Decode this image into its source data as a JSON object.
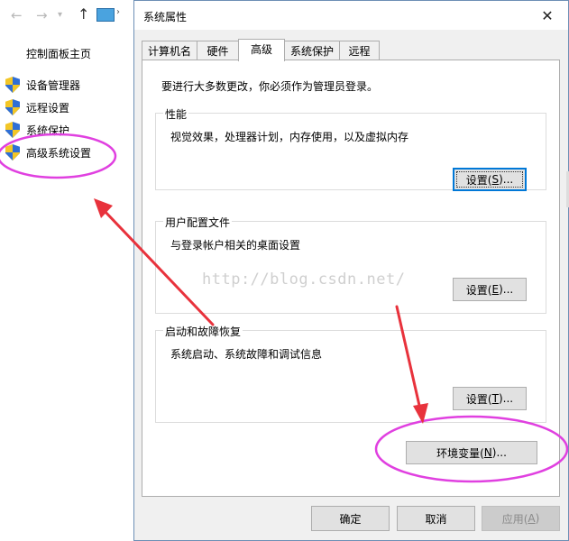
{
  "control_panel": {
    "home_label": "控制面板主页",
    "side_items": [
      {
        "label": "设备管理器"
      },
      {
        "label": "远程设置"
      },
      {
        "label": "系统保护"
      },
      {
        "label": "高级系统设置"
      }
    ]
  },
  "dialog": {
    "title": "系统属性",
    "tabs": [
      {
        "label": "计算机名"
      },
      {
        "label": "硬件"
      },
      {
        "label": "高级",
        "active": true
      },
      {
        "label": "系统保护"
      },
      {
        "label": "远程"
      }
    ],
    "admin_note": "要进行大多数更改，你必须作为管理员登录。",
    "groups": {
      "performance": {
        "title": "性能",
        "desc": "视觉效果，处理器计划，内存使用，以及虚拟内存",
        "button_pre": "设置(",
        "button_key": "S",
        "button_post": ")..."
      },
      "user_profiles": {
        "title": "用户配置文件",
        "desc": "与登录帐户相关的桌面设置",
        "button_pre": "设置(",
        "button_key": "E",
        "button_post": ")..."
      },
      "startup_recovery": {
        "title": "启动和故障恢复",
        "desc": "系统启动、系统故障和调试信息",
        "button_pre": "设置(",
        "button_key": "T",
        "button_post": ")..."
      }
    },
    "env_button": {
      "pre": "环境变量(",
      "key": "N",
      "post": ")..."
    },
    "footer": {
      "ok": "确定",
      "cancel": "取消",
      "apply_pre": "应用(",
      "apply_key": "A",
      "apply_post": ")"
    }
  },
  "watermark": "http://blog.csdn.net/",
  "annotation_colors": {
    "ellipse": "#e040e0",
    "arrow": "#e8323c"
  }
}
